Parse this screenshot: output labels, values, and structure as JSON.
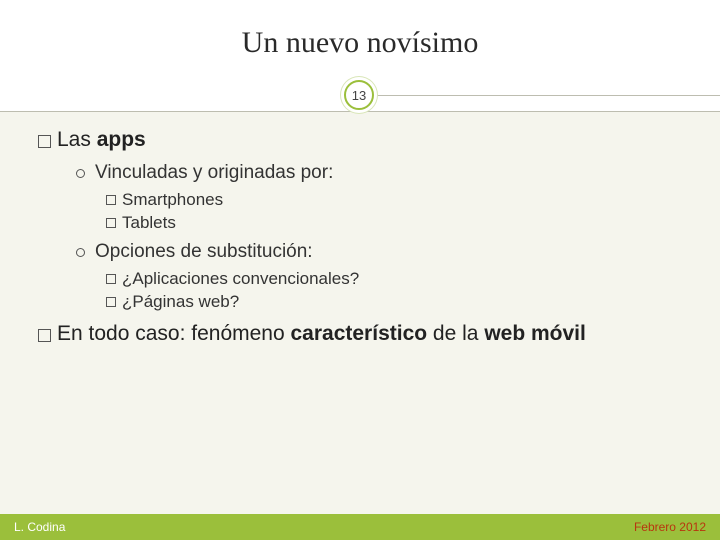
{
  "title": "Un nuevo novísimo",
  "page_number": "13",
  "bullets": {
    "l1a_prefix": "Las ",
    "l1a_bold": "apps",
    "l2a": "Vinculadas y originadas por:",
    "l3a": "Smartphones",
    "l3b": "Tablets",
    "l2b": "Opciones de substitución:",
    "l3c": "¿Aplicaciones convencionales?",
    "l3d": "¿Páginas web?",
    "l1b_prefix": "En todo caso: fenómeno ",
    "l1b_bold1": "característico",
    "l1b_mid": " de la ",
    "l1b_bold2": "web móvil"
  },
  "footer": {
    "author": "L. Codina",
    "date": "Febrero 2012"
  }
}
